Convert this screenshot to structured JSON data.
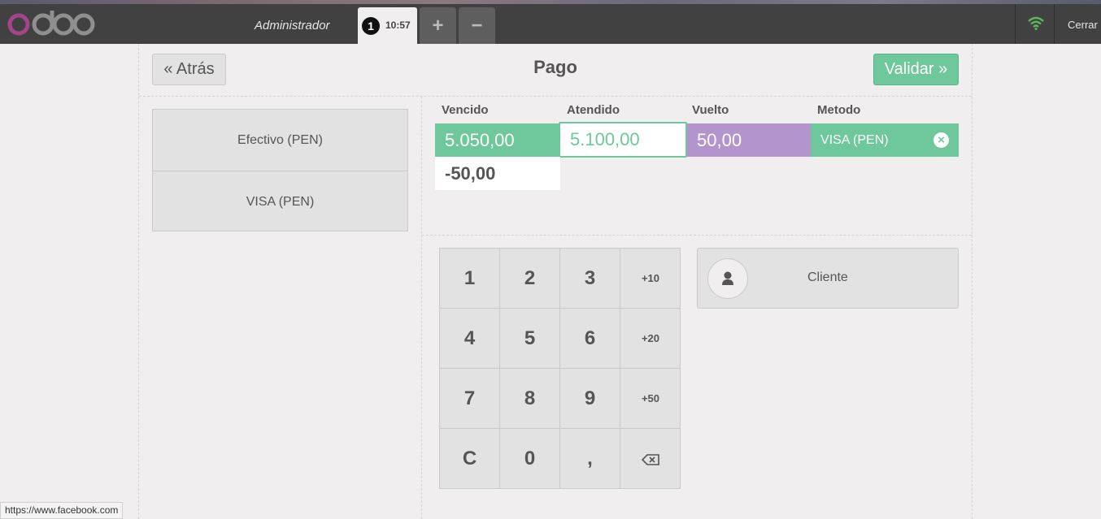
{
  "header": {
    "brand": "odoo",
    "user_name": "Administrador",
    "order_number": "1",
    "order_time": "10:57",
    "add_order_label": "+",
    "remove_order_label": "−",
    "close_label": "Cerrar",
    "wifi_color": "#5cb85c"
  },
  "payment": {
    "back_label": "« Atrás",
    "title": "Pago",
    "validate_label": "Validar »",
    "methods": [
      "Efectivo (PEN)",
      "VISA (PEN)"
    ],
    "columns": {
      "due": "Vencido",
      "tendered": "Atendido",
      "change": "Vuelto",
      "method": "Metodo"
    },
    "line": {
      "due": "5.050,00",
      "tendered": "5.100,00",
      "change": "50,00",
      "method": "VISA (PEN)"
    },
    "remaining": "-50,00"
  },
  "numpad": {
    "keys": [
      "1",
      "2",
      "3",
      "+10",
      "4",
      "5",
      "6",
      "+20",
      "7",
      "8",
      "9",
      "+50",
      "C",
      "0",
      ",",
      "⌫"
    ]
  },
  "client_label": "Cliente",
  "status_url": "https://www.facebook.com",
  "colors": {
    "accent_green": "#6ec89b",
    "change_purple": "#b494cc",
    "header_bg": "#414141"
  }
}
